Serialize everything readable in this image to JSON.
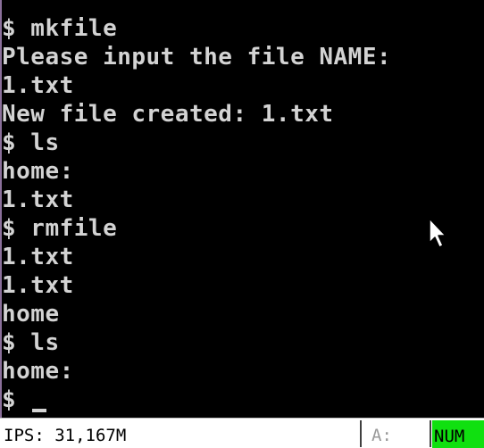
{
  "terminal": {
    "lines": [
      "$ mkfile",
      "Please input the file NAME:",
      "1.txt",
      "New file created: 1.txt",
      "$ ls",
      "home:",
      "1.txt",
      "$ rmfile",
      "1.txt",
      "1.txt",
      "home",
      "$ ls",
      "home:"
    ],
    "prompt": "$"
  },
  "statusbar": {
    "ips": "IPS: 31,167M",
    "drive": "A:",
    "num": "NUM"
  },
  "colors": {
    "background": "#000000",
    "text": "#d3d3d3",
    "num_indicator": "#10e010"
  }
}
